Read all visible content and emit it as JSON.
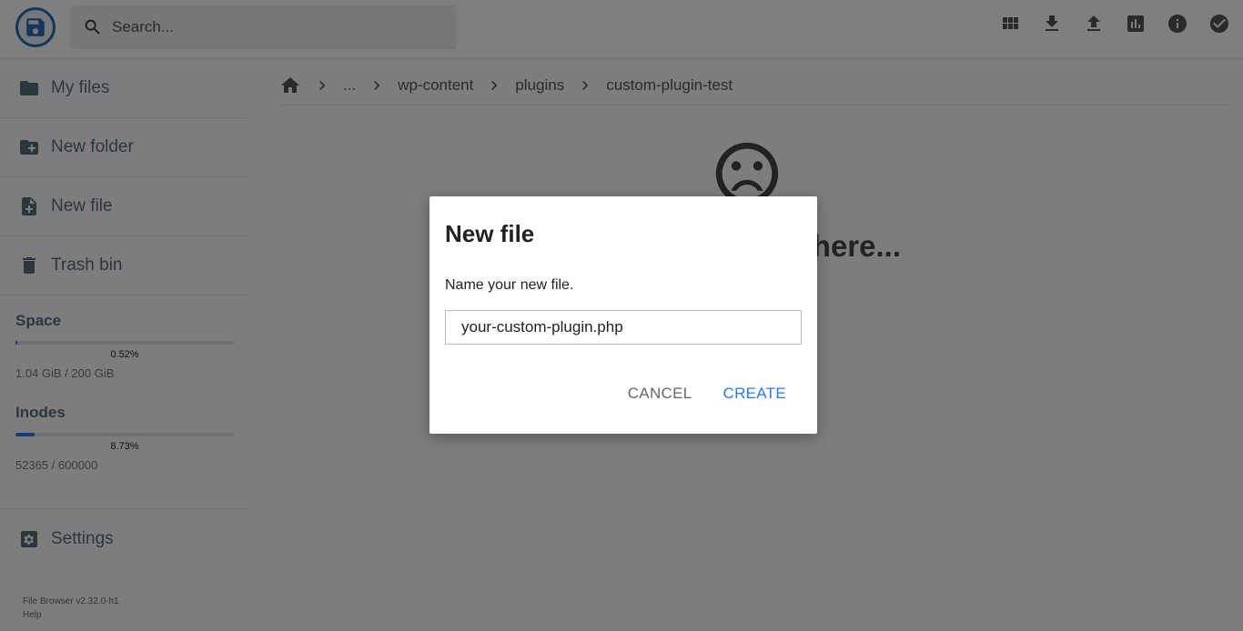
{
  "header": {
    "search_placeholder": "Search...",
    "actions": [
      "view-grid-icon",
      "download-icon",
      "upload-icon",
      "chart-icon",
      "info-icon",
      "check-circle-icon"
    ]
  },
  "sidebar": {
    "items": [
      {
        "label": "My files",
        "icon": "folder-icon"
      },
      {
        "label": "New folder",
        "icon": "new-folder-icon"
      },
      {
        "label": "New file",
        "icon": "new-file-icon"
      },
      {
        "label": "Trash bin",
        "icon": "trash-icon"
      }
    ],
    "space": {
      "title": "Space",
      "percent_label": "0.52%",
      "percent": 0.52,
      "usage": "1.04 GiB / 200 GiB"
    },
    "inodes": {
      "title": "Inodes",
      "percent_label": "8.73%",
      "percent": 8.73,
      "usage": "52365 / 600000"
    },
    "settings_label": "Settings",
    "footer": {
      "version": "File Browser v2.32.0-h1",
      "help": "Help"
    }
  },
  "breadcrumbs": [
    "...",
    "wp-content",
    "plugins",
    "custom-plugin-test"
  ],
  "empty_state": {
    "message": "here..."
  },
  "dialog": {
    "title": "New file",
    "text": "Name your new file.",
    "input_value": "your-custom-plugin.php",
    "cancel_label": "CANCEL",
    "create_label": "CREATE"
  },
  "colors": {
    "accent": "#2979ff",
    "sidebar_text": "#546e7a"
  }
}
